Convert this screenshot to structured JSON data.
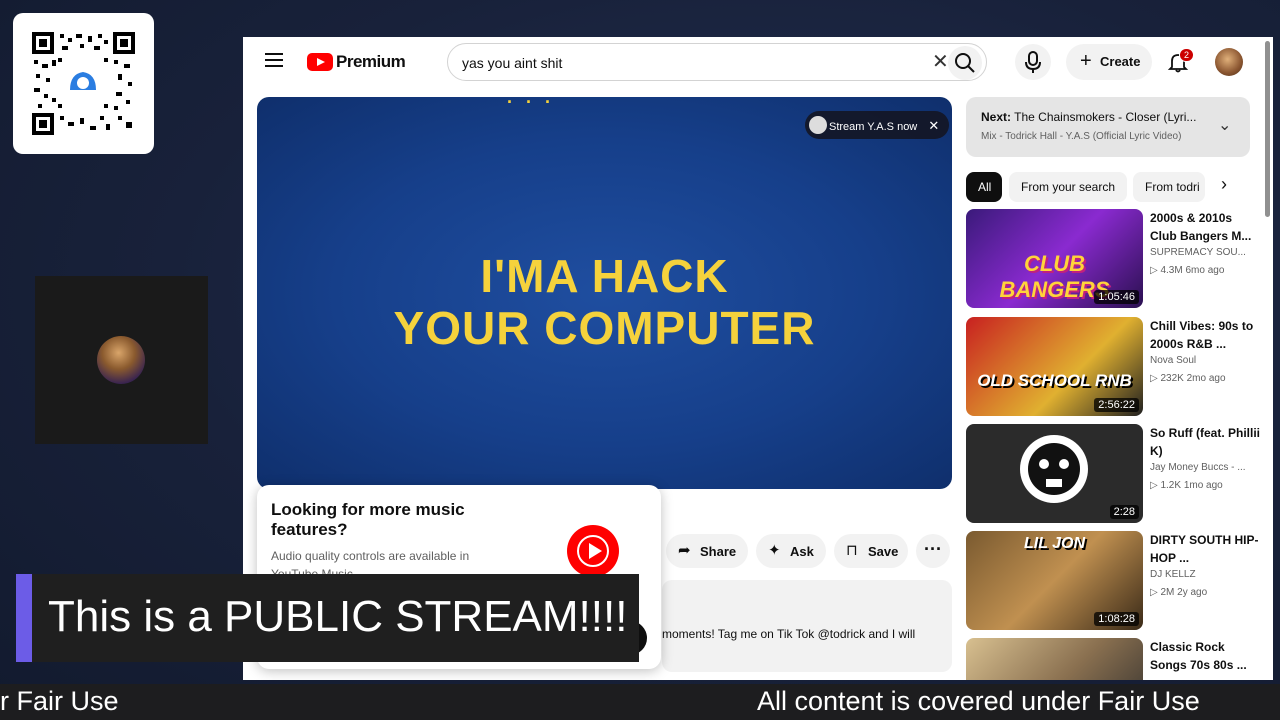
{
  "search": {
    "query": "yas you aint shit"
  },
  "logo": {
    "text": "Premium"
  },
  "header": {
    "create_label": "Create",
    "notif_count": "2"
  },
  "video": {
    "top_text": "...",
    "line1": "I'MA HACK",
    "line2": "YOUR COMPUTER",
    "stream_label": "Stream Y.A.S now"
  },
  "popup": {
    "title": "Looking for more music features?",
    "desc": "Audio quality controls are available in YouTube Music"
  },
  "actions": {
    "share": "Share",
    "ask": "Ask",
    "save": "Save"
  },
  "description": {
    "text": "moments! Tag me on Tik Tok @todrick and I will"
  },
  "next": {
    "prefix": "Next:",
    "title": "The Chainsmokers - Closer (Lyri...",
    "sub": "Mix - Todrick Hall - Y.A.S (Official Lyric Video)"
  },
  "chips": [
    "All",
    "From your search",
    "From todri"
  ],
  "recs": [
    {
      "title": "2000s & 2010s Club Bangers M...",
      "channel": "SUPREMACY SOU...",
      "meta": "▷ 4.3M  6mo ago",
      "duration": "1:05:46",
      "caption": "CLUB BANGERS"
    },
    {
      "title": "Chill Vibes: 90s to 2000s R&B ...",
      "channel": "Nova Soul",
      "meta": "▷ 232K  2mo ago",
      "duration": "2:56:22",
      "caption": "OLD SCHOOL RNB"
    },
    {
      "title": "So Ruff (feat. Phillii K)",
      "channel": "Jay Money Buccs - ...",
      "meta": "▷ 1.2K  1mo ago",
      "duration": "2:28",
      "caption": ""
    },
    {
      "title": "DIRTY SOUTH HIP-HOP ...",
      "channel": "DJ KELLZ",
      "meta": "▷ 2M  2y ago",
      "duration": "1:08:28",
      "caption": "LIL JON"
    },
    {
      "title": "Classic Rock Songs 70s 80s ...",
      "channel": "",
      "meta": "",
      "duration": "",
      "caption": ""
    }
  ],
  "overlay": {
    "banner": "This is a PUBLIC STREAM!!!!",
    "ticker_left": "r Fair Use",
    "ticker_right": "All content is covered under Fair Use"
  }
}
